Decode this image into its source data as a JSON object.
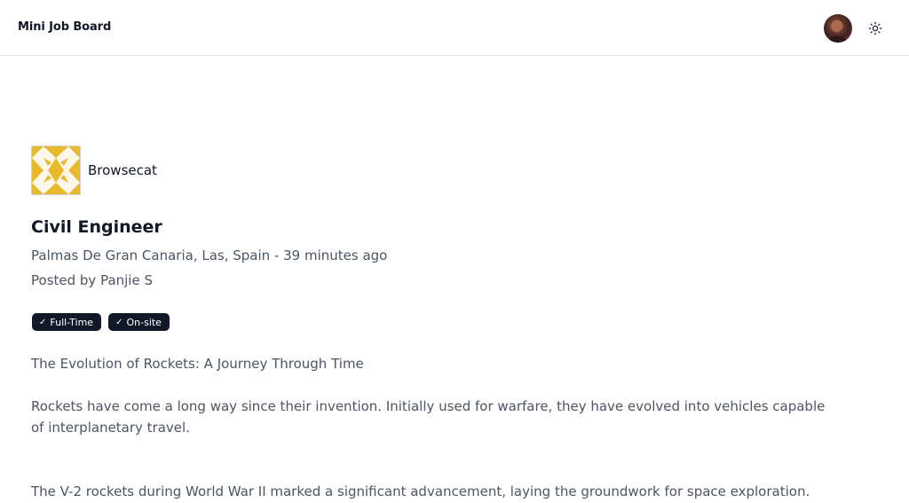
{
  "header": {
    "brand": "Mini Job Board",
    "avatar_icon": "user-avatar",
    "theme_icon": "sun-icon"
  },
  "job": {
    "company": "Browsecat",
    "company_logo_icon": "company-logo-pattern",
    "title": "Civil Engineer",
    "location_line": "Palmas De Gran Canaria, Las, Spain - 39 minutes ago",
    "posted_by": "Posted by Panjie S",
    "tags": [
      {
        "label": "Full-Time",
        "icon": "check-icon"
      },
      {
        "label": "On-site",
        "icon": "check-icon"
      }
    ],
    "description": [
      "The Evolution of Rockets: A Journey Through Time",
      "Rockets have come a long way since their invention. Initially used for warfare, they have evolved into vehicles capable of interplanetary travel.",
      "The V-2 rockets during World War II marked a significant advancement, laying the groundwork for space exploration."
    ]
  },
  "colors": {
    "tag_background": "#111827",
    "text_primary": "#111827",
    "text_muted": "#4b5563",
    "logo_accent": "#e8b92c"
  }
}
